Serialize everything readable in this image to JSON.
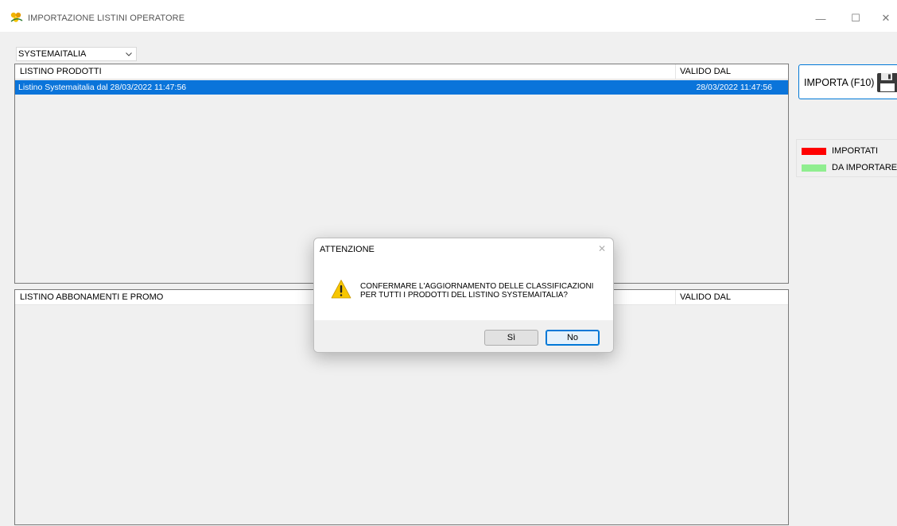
{
  "window": {
    "title": "IMPORTAZIONE LISTINI OPERATORE",
    "controls": {
      "minimize": "—",
      "maximize": "☐",
      "close": "✕"
    }
  },
  "operator_select": {
    "value": "SYSTEMAITALIA"
  },
  "listino_prodotti": {
    "columns": [
      "LISTINO PRODOTTI",
      "VALIDO DAL"
    ],
    "rows": [
      {
        "name": "Listino Systemaitalia dal 28/03/2022 11:47:56",
        "valid_from": "28/03/2022 11:47:56",
        "selected": true
      }
    ]
  },
  "listino_abbonamenti": {
    "columns": [
      "LISTINO ABBONAMENTI E PROMO",
      "VALIDO DAL"
    ],
    "rows": []
  },
  "import_button": {
    "label": "IMPORTA (F10)",
    "icon": "floppy-disk-icon"
  },
  "legend": {
    "items": [
      {
        "label": "IMPORTATI",
        "color": "#ff0000"
      },
      {
        "label": "DA IMPORTARE",
        "color": "#90ee90"
      }
    ]
  },
  "dialog": {
    "title": "ATTENZIONE",
    "close": "✕",
    "icon": "warning-icon",
    "message_line1": "CONFERMARE L'AGGIORNAMENTO DELLE CLASSIFICAZIONI",
    "message_line2": "PER TUTTI I PRODOTTI DEL LISTINO SYSTEMAITALIA?",
    "yes_label": "Sì",
    "no_label": "No"
  },
  "colors": {
    "selection": "#0a74da",
    "accent": "#0078d7",
    "warning": "#f7c600"
  }
}
